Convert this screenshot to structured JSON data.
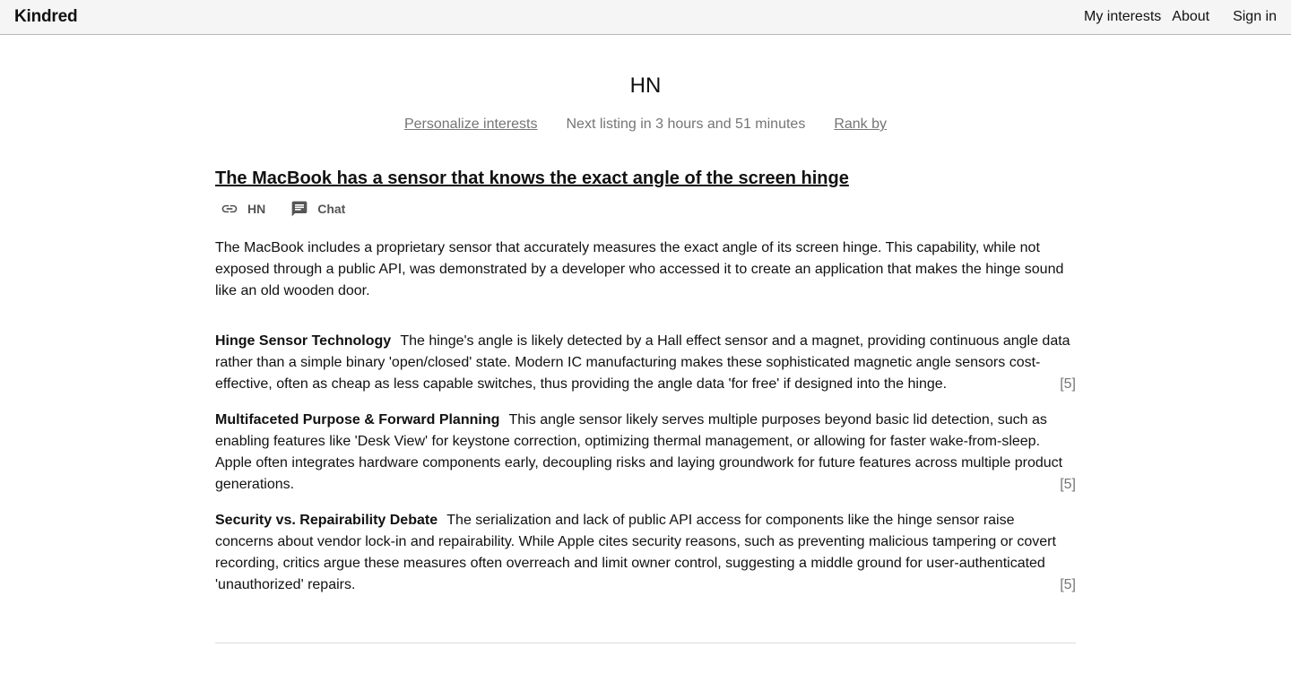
{
  "header": {
    "brand": "Kindred",
    "nav": [
      "My interests",
      "About",
      "Sign in"
    ]
  },
  "page": {
    "title": "HN",
    "personalize_label": "Personalize interests",
    "next_listing": "Next listing in 3 hours and 51 minutes",
    "rank_label": "Rank by"
  },
  "story": {
    "headline": "The MacBook has a sensor that knows the exact angle of the screen hinge",
    "source_label": "HN",
    "chat_label": "Chat",
    "summary": "The MacBook includes a proprietary sensor that accurately measures the exact angle of its screen hinge. This capability, while not exposed through a public API, was demonstrated by a developer who accessed it to create an application that makes the hinge sound like an old wooden door.",
    "points": [
      {
        "title": "Hinge Sensor Technology",
        "text": "The hinge's angle is likely detected by a Hall effect sensor and a magnet, providing continuous angle data rather than a simple binary 'open/closed' state. Modern IC manufacturing makes these sophisticated magnetic angle sensors cost-effective, often as cheap as less capable switches, thus providing the angle data 'for free' if designed into the hinge.",
        "cite": "[5]"
      },
      {
        "title": "Multifaceted Purpose & Forward Planning",
        "text": "This angle sensor likely serves multiple purposes beyond basic lid detection, such as enabling features like 'Desk View' for keystone correction, optimizing thermal management, or allowing for faster wake-from-sleep. Apple often integrates hardware components early, decoupling risks and laying groundwork for future features across multiple product generations.",
        "cite": "[5]"
      },
      {
        "title": "Security vs. Repairability Debate",
        "text": "The serialization and lack of public API access for components like the hinge sensor raise concerns about vendor lock-in and repairability. While Apple cites security reasons, such as preventing malicious tampering or covert recording, critics argue these measures often overreach and limit owner control, suggesting a middle ground for user-authenticated 'unauthorized' repairs.",
        "cite": "[5]"
      }
    ]
  },
  "icons": {
    "source": "link-icon",
    "chat": "chat-bubble-icon"
  }
}
